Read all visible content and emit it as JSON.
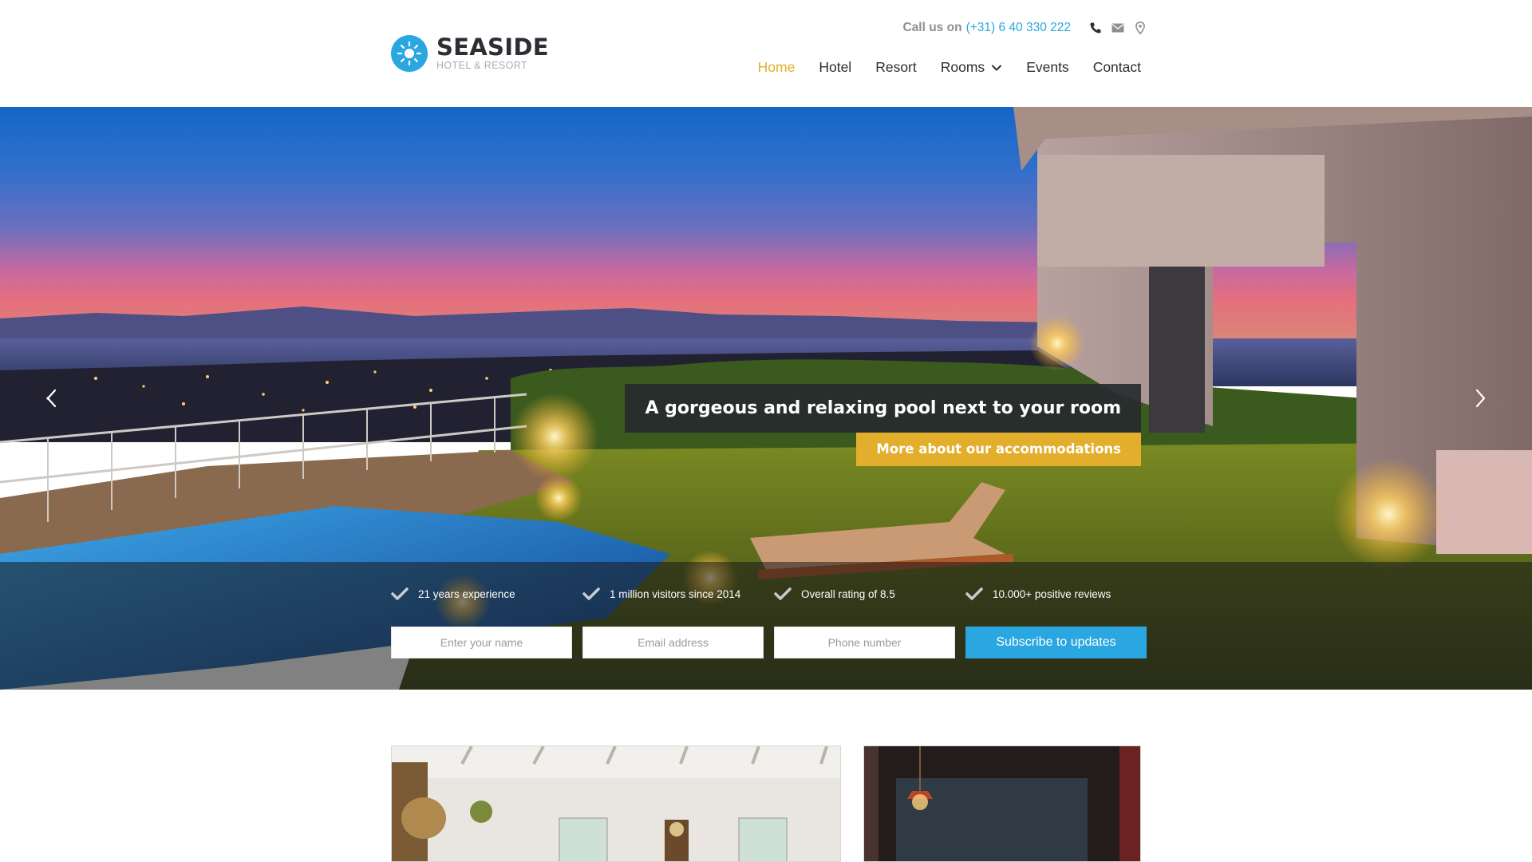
{
  "brand": {
    "name": "SEASIDE",
    "tagline": "HOTEL & RESORT",
    "accent": "#2aa7e0",
    "gold": "#e4ae2d",
    "dark": "#2b2f33"
  },
  "header": {
    "call_label": "Call us on",
    "phone": "(+31) 6 40 330 222",
    "icons": [
      "phone-icon",
      "mail-icon",
      "location-pin-icon"
    ]
  },
  "nav": {
    "items": [
      {
        "label": "Home",
        "active": true
      },
      {
        "label": "Hotel"
      },
      {
        "label": "Resort"
      },
      {
        "label": "Rooms",
        "dropdown": true
      },
      {
        "label": "Events"
      },
      {
        "label": "Contact"
      }
    ]
  },
  "hero": {
    "caption": "A gorgeous and relaxing pool next to your room",
    "cta": "More about our accommodations",
    "prev_icon": "chevron-left-icon",
    "next_icon": "chevron-right-icon",
    "features": [
      "21 years experience",
      "1 million visitors since 2014",
      "Overall rating of 8.5",
      "10.000+ positive reviews"
    ]
  },
  "form": {
    "name_placeholder": "Enter your name",
    "email_placeholder": "Email address",
    "phone_placeholder": "Phone number",
    "submit": "Subscribe to updates"
  }
}
